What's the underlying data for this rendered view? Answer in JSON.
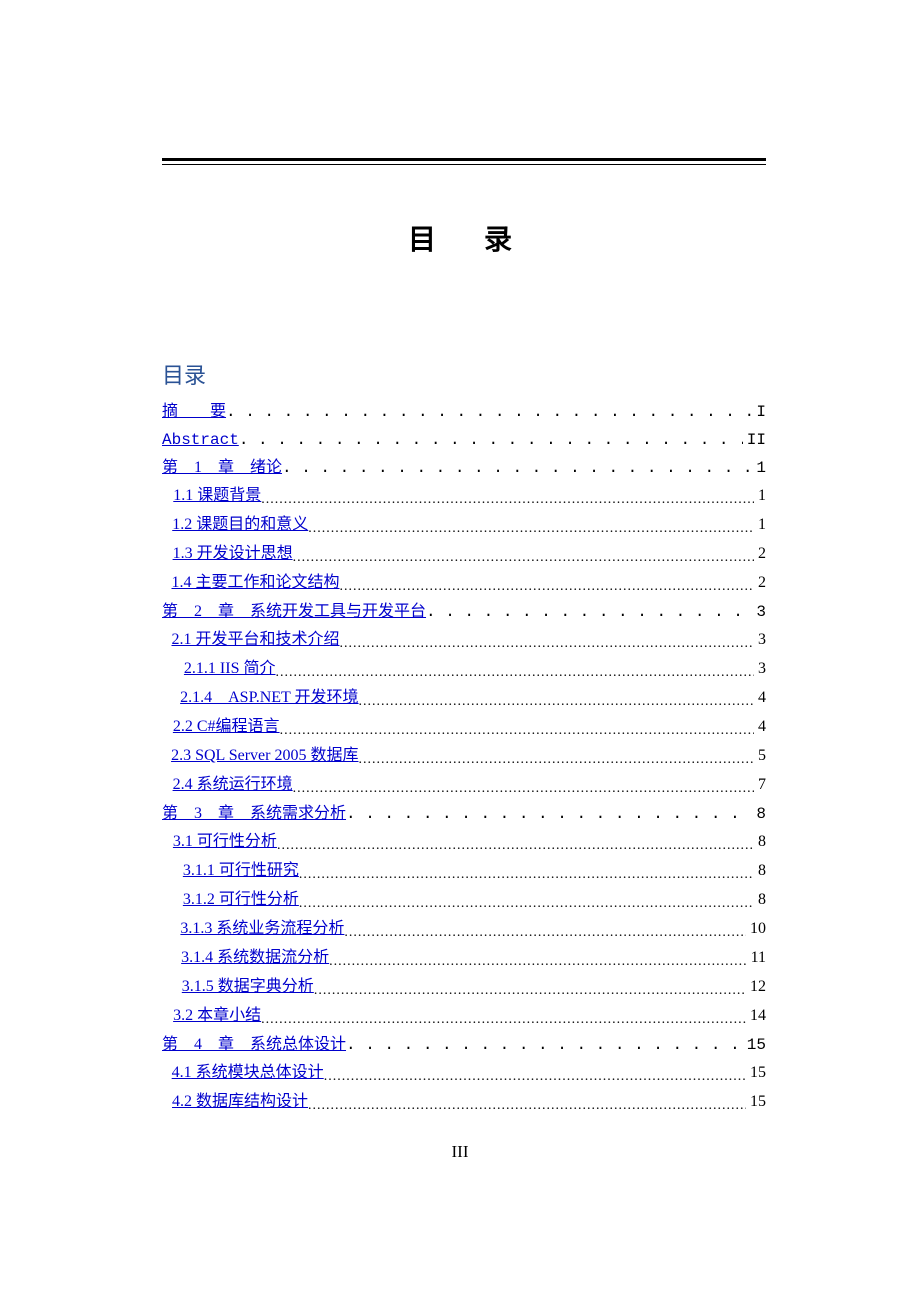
{
  "title": {
    "ch1": "目",
    "ch2": "录"
  },
  "subhead": "目录",
  "footer": "III",
  "toc": [
    {
      "level": 0,
      "kind": "ch",
      "label": "摘　　要",
      "mono": true,
      "page": "I"
    },
    {
      "level": 0,
      "kind": "ch",
      "label": "Abstract",
      "mono": true,
      "page": "II"
    },
    {
      "level": 0,
      "kind": "ch",
      "label": "第　1　章　绪论",
      "mono": false,
      "page": "1"
    },
    {
      "level": 1,
      "kind": "sec",
      "label": "1.1  课题背景",
      "page": "1"
    },
    {
      "level": 1,
      "kind": "sec",
      "label": "1.2  课题目的和意义",
      "page": "1"
    },
    {
      "level": 1,
      "kind": "sec",
      "label": "1.3  开发设计思想",
      "page": "2"
    },
    {
      "level": 1,
      "kind": "sec",
      "label": "1.4  主要工作和论文结构",
      "page": "2"
    },
    {
      "level": 0,
      "kind": "ch",
      "label": "第　2　章　系统开发工具与开发平台",
      "mono": false,
      "page": "3"
    },
    {
      "level": 1,
      "kind": "sec",
      "label": "2.1  开发平台和技术介绍",
      "page": "3"
    },
    {
      "level": 2,
      "kind": "sub",
      "label": "2.1.1 IIS 简介",
      "page": "3"
    },
    {
      "level": 2,
      "kind": "sub",
      "label": "2.1.4　ASP.NET 开发环境",
      "page": "4"
    },
    {
      "level": 1,
      "kind": "sec",
      "label": "2.2 C#编程语言",
      "page": "4"
    },
    {
      "level": 1,
      "kind": "sec",
      "label": "2.3 SQL Server 2005 数据库",
      "page": "5"
    },
    {
      "level": 1,
      "kind": "sec",
      "label": "2.4  系统运行环境",
      "page": "7"
    },
    {
      "level": 0,
      "kind": "ch",
      "label": "第　3　章　系统需求分析",
      "mono": false,
      "page": "8"
    },
    {
      "level": 1,
      "kind": "sec",
      "label": "3.1  可行性分析",
      "page": "8"
    },
    {
      "level": 2,
      "kind": "sub",
      "label": "3.1.1  可行性研究",
      "page": "8"
    },
    {
      "level": 2,
      "kind": "sub",
      "label": "3.1.2  可行性分析",
      "page": "8"
    },
    {
      "level": 2,
      "kind": "sub",
      "label": "3.1.3  系统业务流程分析",
      "page": "10"
    },
    {
      "level": 2,
      "kind": "sub",
      "label": "3.1.4  系统数据流分析",
      "page": "11"
    },
    {
      "level": 2,
      "kind": "sub",
      "label": "3.1.5  数据字典分析",
      "page": "12"
    },
    {
      "level": 1,
      "kind": "sec",
      "label": "3.2  本章小结",
      "page": "14"
    },
    {
      "level": 0,
      "kind": "ch",
      "label": "第　4　章　系统总体设计",
      "mono": false,
      "page": "15"
    },
    {
      "level": 1,
      "kind": "sec",
      "label": "4.1  系统模块总体设计",
      "page": "15"
    },
    {
      "level": 1,
      "kind": "sec",
      "label": "4.2  数据库结构设计",
      "page": "15"
    }
  ]
}
